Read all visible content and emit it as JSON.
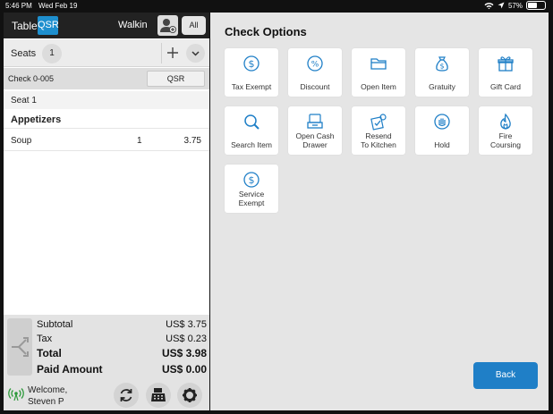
{
  "status_bar": {
    "time": "5:46 PM",
    "date": "Wed Feb 19",
    "battery": "57%",
    "battery_level": 0.57
  },
  "left_panel": {
    "header": {
      "table_label": "Table",
      "mode_badge": "QSR",
      "customer": "Walkin",
      "all_button": "All"
    },
    "seats": {
      "label": "Seats",
      "count": "1"
    },
    "check": {
      "label": "Check  0-005",
      "type_button": "QSR"
    },
    "seat_header": "Seat 1",
    "category": "Appetizers",
    "items": [
      {
        "name": "Soup",
        "qty": "1",
        "price": "3.75"
      }
    ],
    "totals": {
      "subtotal_label": "Subtotal",
      "subtotal_value": "US$ 3.75",
      "tax_label": "Tax",
      "tax_value": "US$ 0.23",
      "total_label": "Total",
      "total_value": "US$ 3.98",
      "paid_label": "Paid Amount",
      "paid_value": "US$ 0.00"
    },
    "footer": {
      "welcome_line1": "Welcome,",
      "welcome_line2": "Steven P"
    }
  },
  "right_panel": {
    "title": "Check Options",
    "options": [
      {
        "label": "Tax Exempt",
        "icon": "dollar-circle-icon"
      },
      {
        "label": "Discount",
        "icon": "percent-circle-icon"
      },
      {
        "label": "Open Item",
        "icon": "folder-icon"
      },
      {
        "label": "Gratuity",
        "icon": "money-bag-icon"
      },
      {
        "label": "Gift Card",
        "icon": "gift-icon"
      },
      {
        "label": "Search Item",
        "icon": "search-icon"
      },
      {
        "label": "Open Cash\nDrawer",
        "icon": "cash-drawer-icon"
      },
      {
        "label": "Resend\nTo Kitchen",
        "icon": "resend-icon"
      },
      {
        "label": "Hold",
        "icon": "hand-icon"
      },
      {
        "label": "Fire\nCoursing",
        "icon": "fire-icon"
      },
      {
        "label": "Service\nExempt",
        "icon": "dollar-circle-icon"
      }
    ],
    "back_button": "Back"
  },
  "colors": {
    "accent": "#1f7fc7",
    "icon": "#1f7fc7",
    "header_bg": "#222222",
    "panel_bg": "#e5e5e5"
  }
}
